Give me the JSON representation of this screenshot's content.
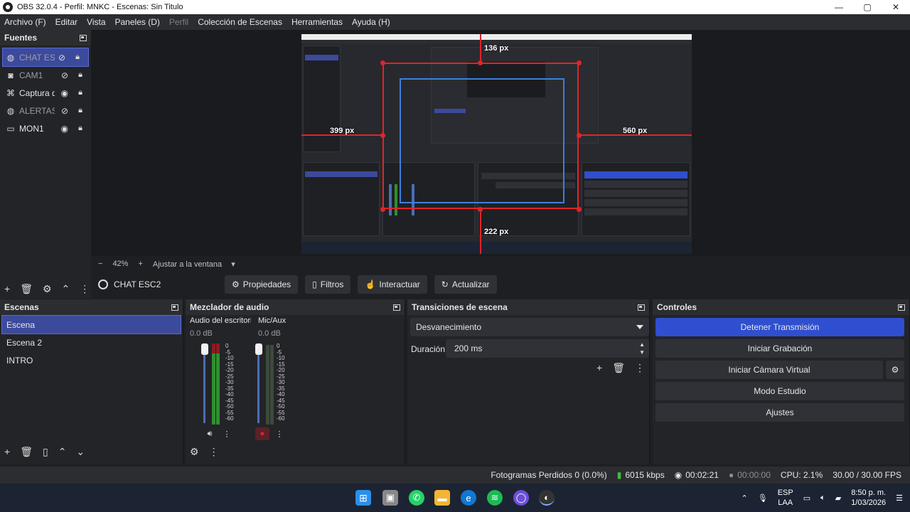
{
  "window": {
    "title": "OBS 32.0.4 - Perfil: MNKC - Escenas: Sin Titulo",
    "controls": [
      "—",
      "▢",
      "✕"
    ]
  },
  "menu": [
    "Archivo (F)",
    "Editar",
    "Vista",
    "Paneles (D)",
    "Perfil",
    "Colección de Escenas",
    "Herramientas",
    "Ayuda (H)"
  ],
  "sources": {
    "title": "Fuentes",
    "items": [
      {
        "label": "CHAT ESC",
        "icon": "globe-icon",
        "visible": false
      },
      {
        "label": "CAM1",
        "icon": "camera-icon",
        "visible": false
      },
      {
        "label": "Captura d",
        "icon": "gamepad-icon",
        "visible": true
      },
      {
        "label": "ALERTAS",
        "icon": "globe-icon",
        "visible": false
      },
      {
        "label": "MON1",
        "icon": "monitor-icon",
        "visible": true
      }
    ]
  },
  "preview": {
    "measures": {
      "top": "136 px",
      "left": "399 px",
      "right": "560 px",
      "bottom": "222 px"
    }
  },
  "zoom": {
    "minus": "−",
    "value": "42%",
    "plus": "+",
    "fit": "Ajustar a la ventana"
  },
  "source_toolbar": {
    "current": "CHAT ESC2",
    "buttons": [
      "Propiedades",
      "Filtros",
      "Interactuar",
      "Actualizar"
    ]
  },
  "scenes": {
    "title": "Escenas",
    "items": [
      "Escena",
      "Escena 2",
      "INTRO"
    ]
  },
  "mixer": {
    "title": "Mezclador de audio",
    "channels": [
      {
        "name": "Audio del escritorio",
        "db": "0.0 dB"
      },
      {
        "name": "Mic/Aux",
        "db": "0.0 dB"
      }
    ],
    "scale": [
      "0",
      "-5",
      "-10",
      "-15",
      "-20",
      "-25",
      "-30",
      "-35",
      "-40",
      "-45",
      "-50",
      "-55",
      "-60"
    ]
  },
  "transitions": {
    "title": "Transiciones de escena",
    "selected": "Desvanecimiento",
    "duration_label": "Duración",
    "duration_value": "200 ms"
  },
  "controls": {
    "title": "Controles",
    "buttons": [
      "Detener Transmisión",
      "Iniciar Grabación",
      "Iniciar Cámara Virtual",
      "Modo Estudio",
      "Ajustes"
    ]
  },
  "status": {
    "dropped": "Fotogramas Perdidos 0 (0.0%)",
    "bitrate": "6015 kbps",
    "stream_time": "00:02:21",
    "rec_time": "00:00:00",
    "cpu": "CPU: 2.1%",
    "fps": "30.00 / 30.00 FPS"
  },
  "tray": {
    "lang1": "ESP",
    "lang2": "LAA",
    "time": "8:50 p. m.",
    "date": "1/03/2026"
  },
  "colors": {
    "accent": "#3c4a9c",
    "stream_button": "#2f4fd0",
    "measure": "#e0242a",
    "bounds": "#3f7fdc"
  }
}
